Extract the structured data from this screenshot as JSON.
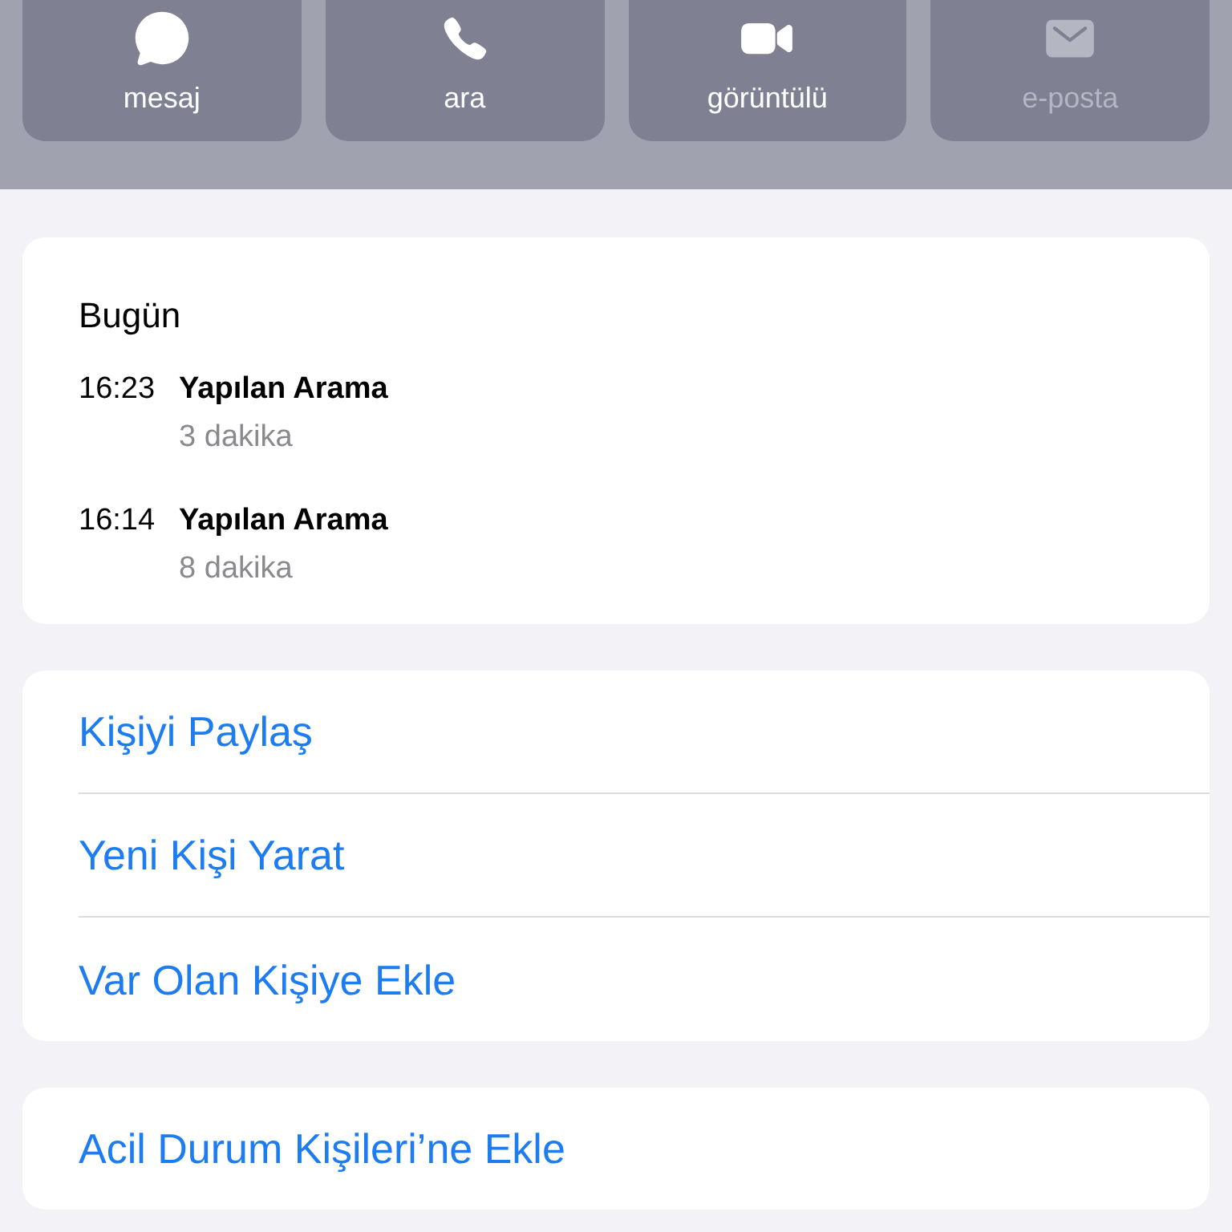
{
  "actions": [
    {
      "kind": "message",
      "label": "mesaj",
      "disabled": false
    },
    {
      "kind": "call",
      "label": "ara",
      "disabled": false
    },
    {
      "kind": "video",
      "label": "görüntülü",
      "disabled": false
    },
    {
      "kind": "email",
      "label": "e-posta",
      "disabled": true
    }
  ],
  "recents": {
    "heading": "Bugün",
    "calls": [
      {
        "time": "16:23",
        "type": "Yapılan Arama",
        "duration": "3 dakika"
      },
      {
        "time": "16:14",
        "type": "Yapılan Arama",
        "duration": "8 dakika"
      }
    ]
  },
  "contact_actions": [
    "Kişiyi Paylaş",
    "Yeni Kişi Yarat",
    "Var Olan Kişiye Ekle"
  ],
  "emergency_action": "Acil Durum Kişileri’ne Ekle"
}
